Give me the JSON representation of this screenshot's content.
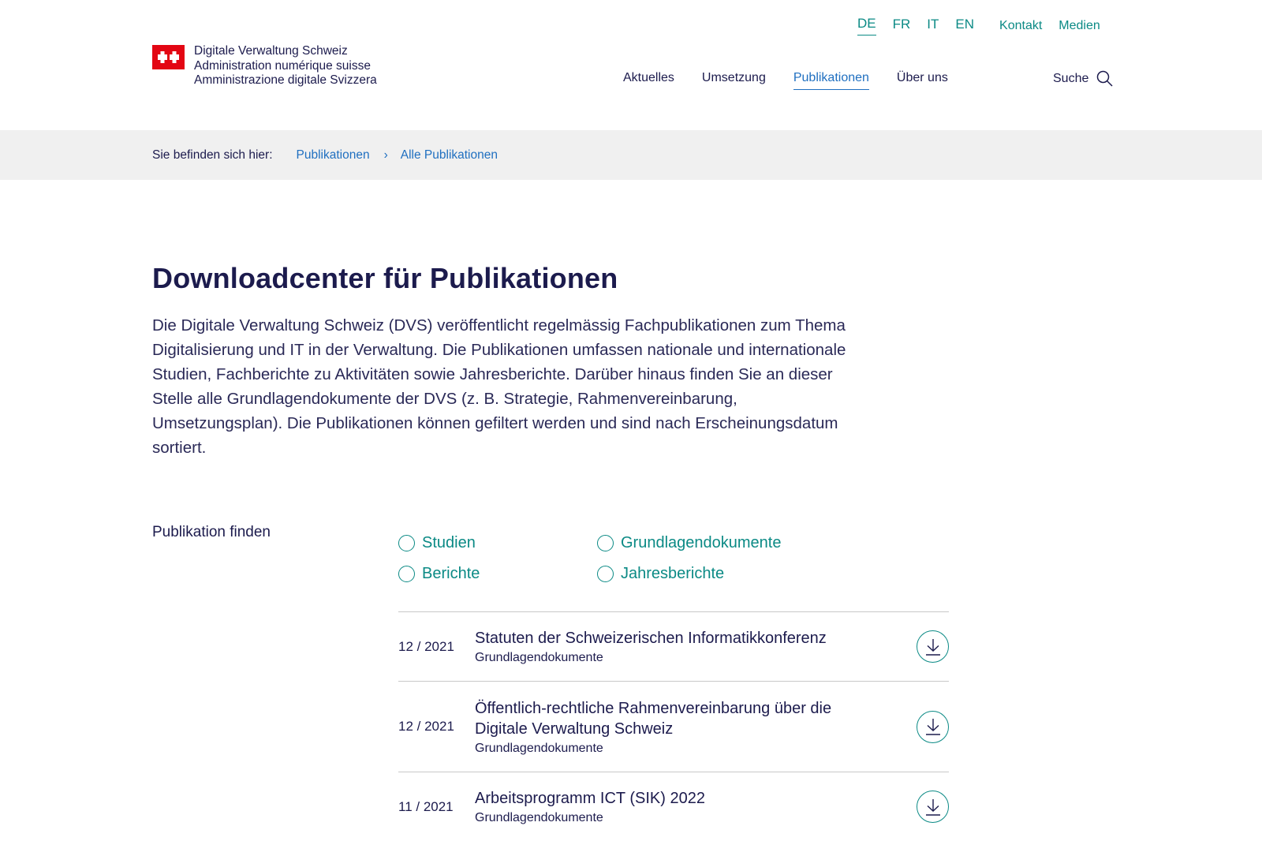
{
  "header": {
    "languages": [
      {
        "code": "DE",
        "active": true
      },
      {
        "code": "FR",
        "active": false
      },
      {
        "code": "IT",
        "active": false
      },
      {
        "code": "EN",
        "active": false
      }
    ],
    "top_links": [
      "Kontakt",
      "Medien"
    ],
    "logo": {
      "lines": [
        "Digitale Verwaltung Schweiz",
        "Administration numérique suisse",
        "Amministrazione digitale Svizzera"
      ],
      "flag_color": "#e30613"
    },
    "nav": [
      {
        "label": "Aktuelles",
        "active": false
      },
      {
        "label": "Umsetzung",
        "active": false
      },
      {
        "label": "Publikationen",
        "active": true
      },
      {
        "label": "Über uns",
        "active": false
      }
    ],
    "search_label": "Suche",
    "search_icon": "search-icon"
  },
  "breadcrumb": {
    "prefix": "Sie befinden sich hier:",
    "items": [
      "Publikationen",
      "Alle Publikationen"
    ]
  },
  "main": {
    "title": "Downloadcenter für Publikationen",
    "intro": "Die Digitale Verwaltung Schweiz (DVS) veröffentlicht regelmässig Fachpublikationen zum Thema Digitalisierung und IT in der Verwaltung. Die Publikationen umfassen nationale und internationale Studien, Fachberichte zu Aktivitäten sowie Jahresberichte. Darüber hinaus finden Sie an dieser Stelle alle Grundlagendokumente der DVS (z. B. Strategie, Rahmenvereinbarung, Umsetzungsplan). Die Publikationen können gefiltert werden und sind nach Erscheinungsdatum sortiert.",
    "filter_label": "Publikation finden",
    "filters": [
      "Studien",
      "Grundlagendokumente",
      "Berichte",
      "Jahresberichte"
    ],
    "publications": [
      {
        "date": "12 / 2021",
        "title": "Statuten der Schweizerischen Informatikkonferenz",
        "category": "Grundlagendokumente"
      },
      {
        "date": "12 / 2021",
        "title": "Öffentlich-rechtliche Rahmenvereinbarung über die Digitale Verwaltung Schweiz",
        "category": "Grundlagendokumente"
      },
      {
        "date": "11 / 2021",
        "title": "Arbeitsprogramm ICT (SIK) 2022",
        "category": "Grundlagendokumente"
      }
    ]
  },
  "colors": {
    "teal": "#0b8a85",
    "blue": "#1f6fc0",
    "navy": "#1c1b4d",
    "breadcrumb_bg": "#f0f0f0"
  }
}
